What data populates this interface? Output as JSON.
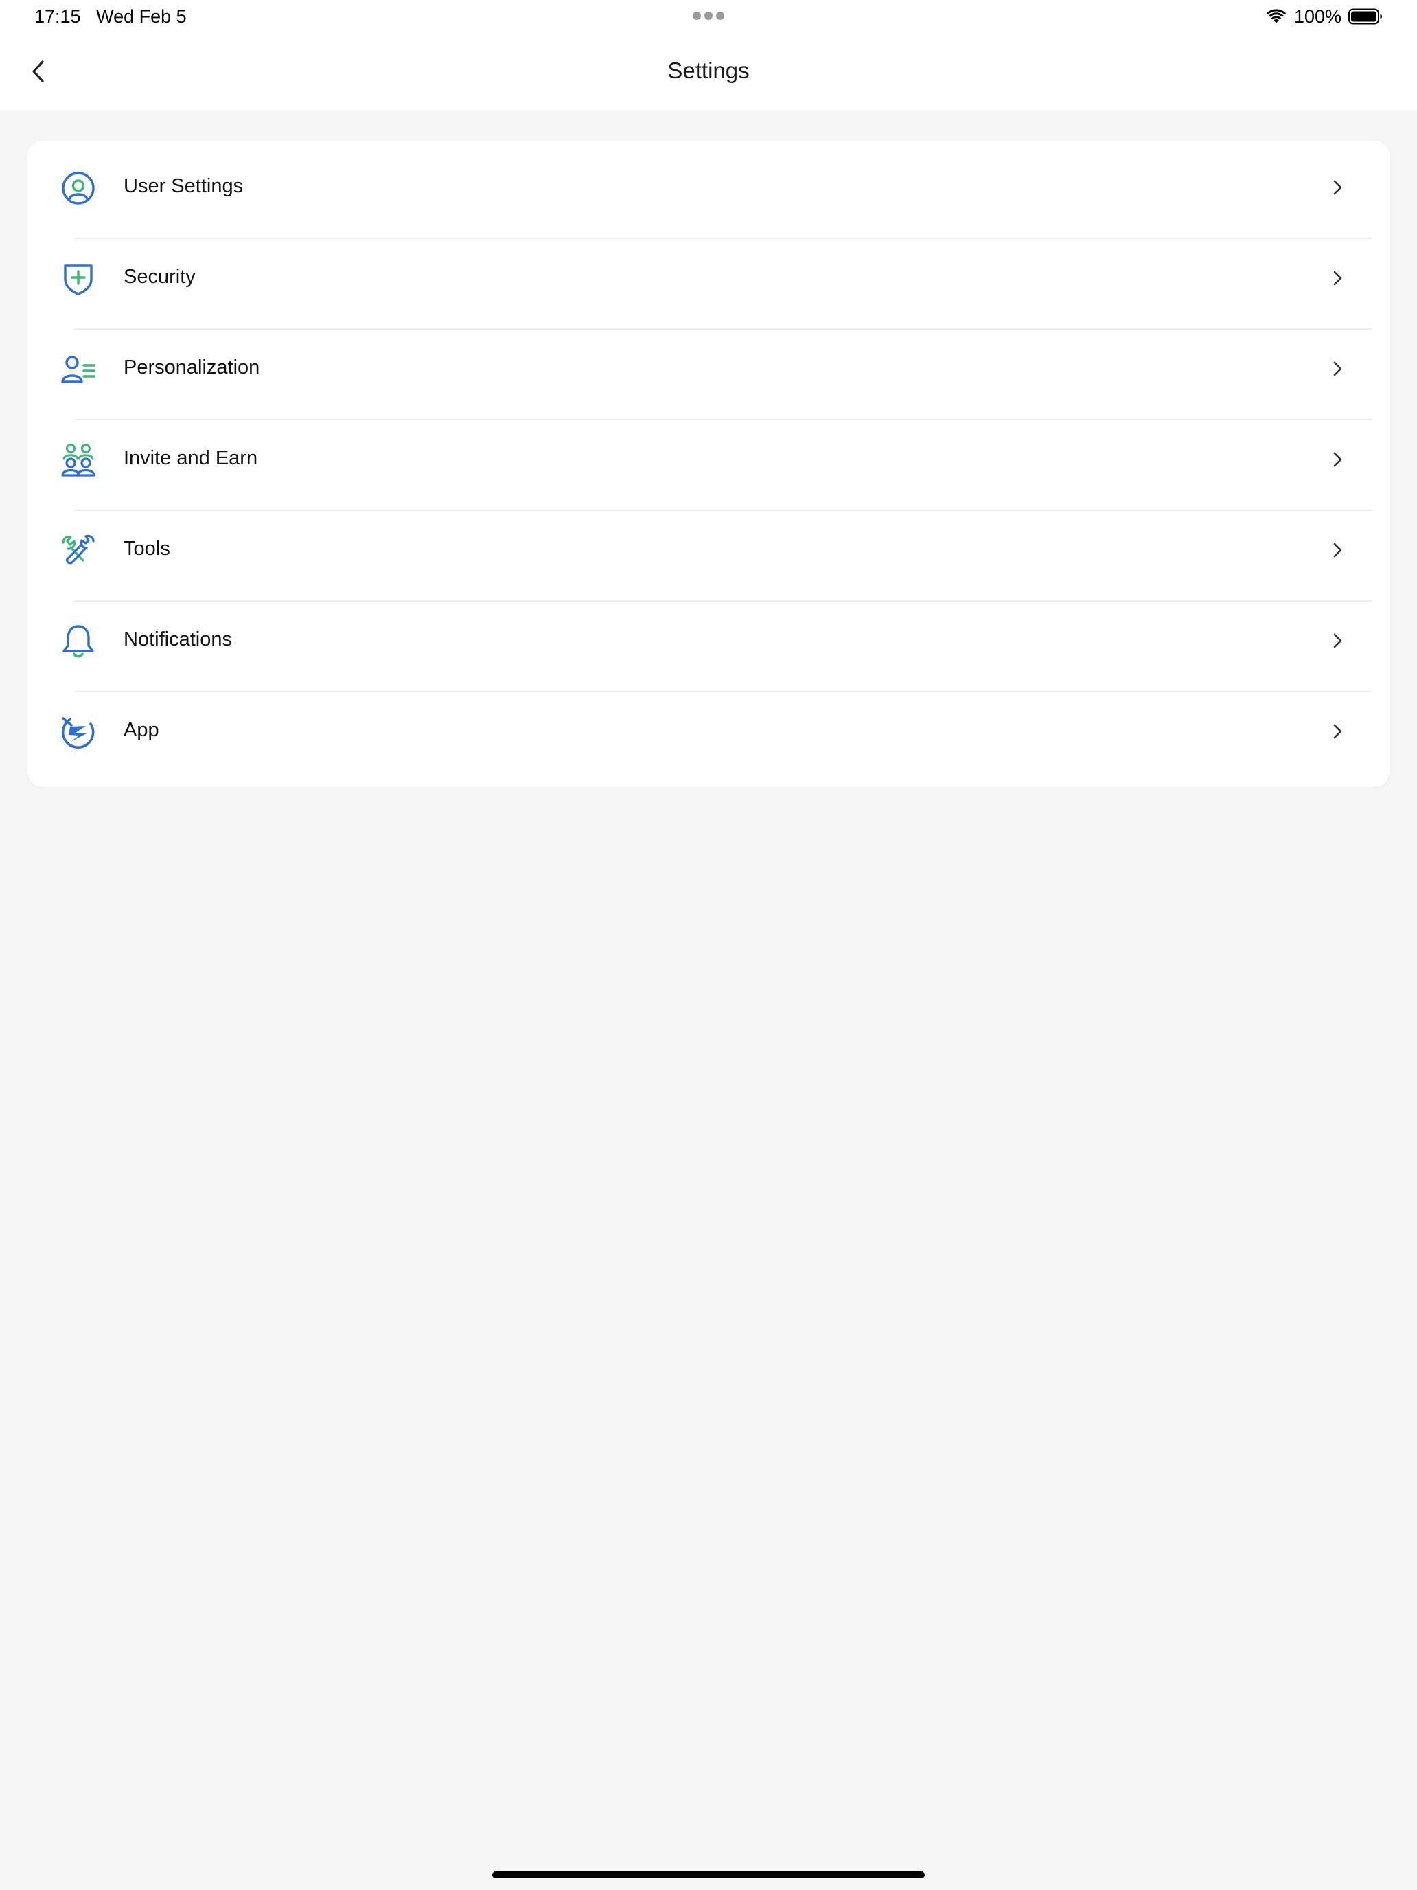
{
  "status_bar": {
    "time": "17:15",
    "date": "Wed Feb 5",
    "battery": "100%"
  },
  "header": {
    "title": "Settings"
  },
  "menu": {
    "items": [
      {
        "label": "User Settings",
        "icon": "user-circle-icon"
      },
      {
        "label": "Security",
        "icon": "shield-plus-icon"
      },
      {
        "label": "Personalization",
        "icon": "user-list-icon"
      },
      {
        "label": "Invite and Earn",
        "icon": "group-icon"
      },
      {
        "label": "Tools",
        "icon": "wrench-icon"
      },
      {
        "label": "Notifications",
        "icon": "bell-icon"
      },
      {
        "label": "App",
        "icon": "app-logo-icon"
      }
    ]
  },
  "colors": {
    "accent_blue": "#2f6fd0",
    "accent_green": "#3cb878",
    "background": "#f5f5f5",
    "card": "#ffffff",
    "divider": "#ededed"
  }
}
